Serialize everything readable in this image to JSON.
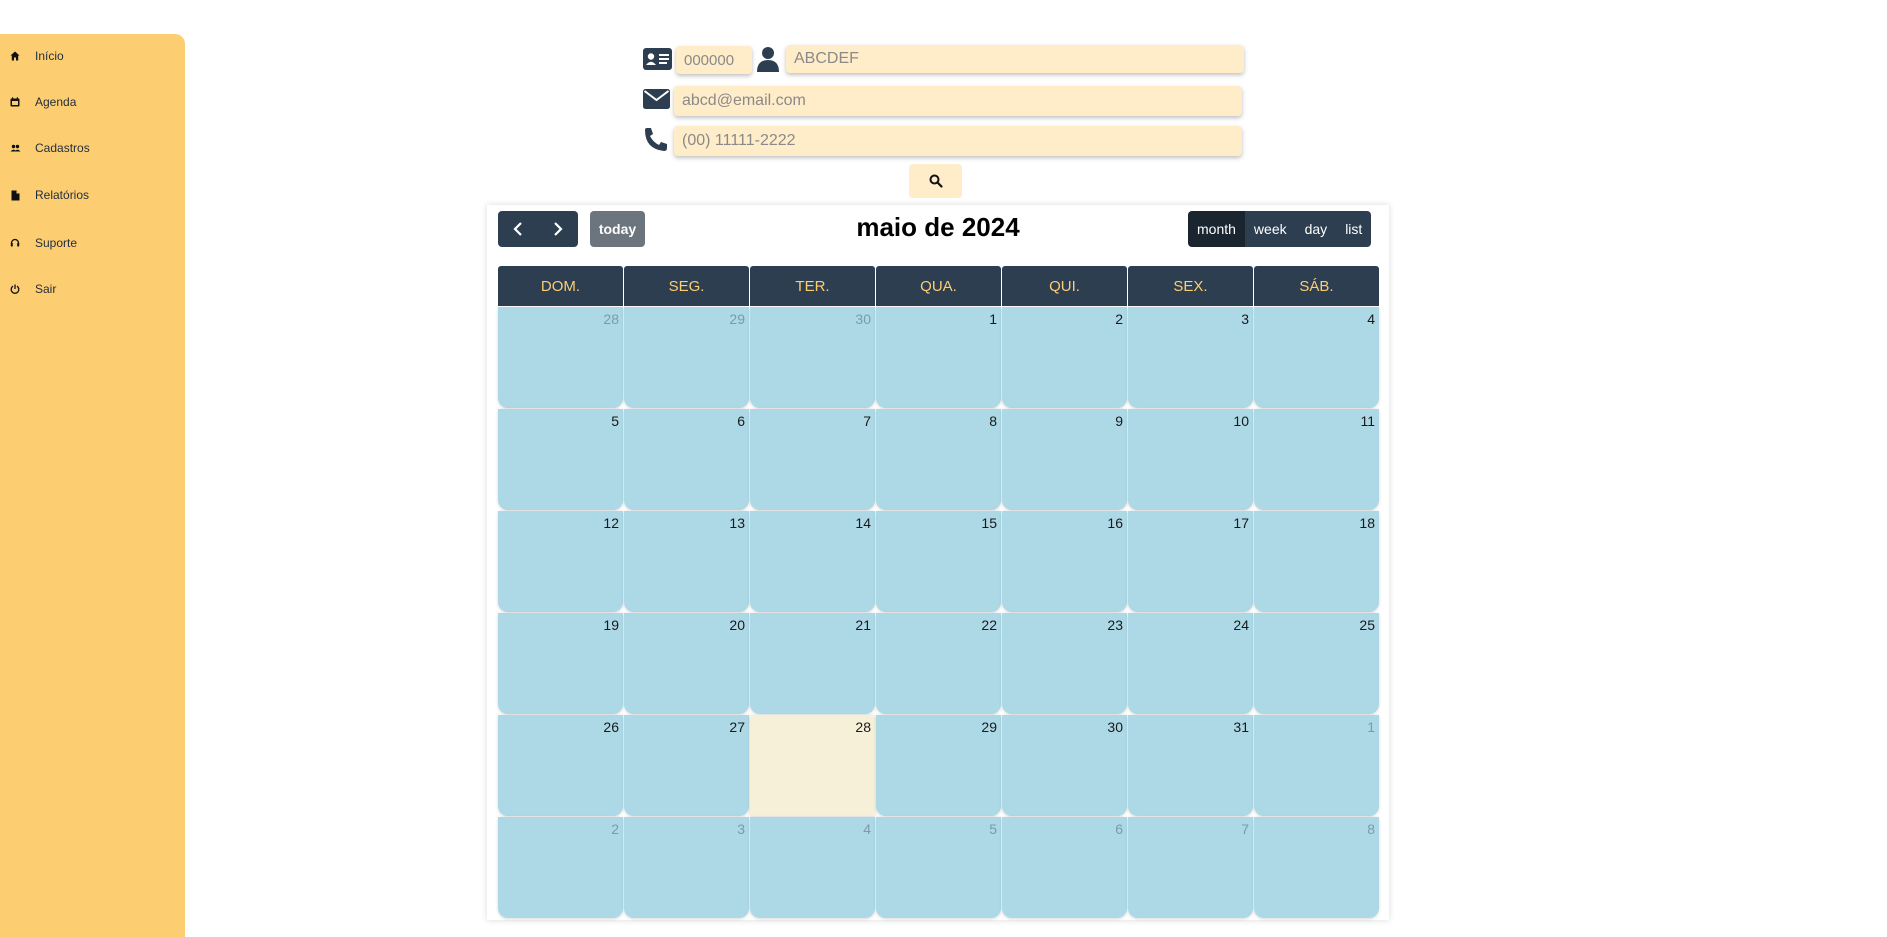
{
  "sidebar": {
    "items": [
      {
        "label": "Início",
        "icon": "home-icon"
      },
      {
        "label": "Agenda",
        "icon": "calendar-icon"
      },
      {
        "label": "Cadastros",
        "icon": "users-icon"
      },
      {
        "label": "Relatórios",
        "icon": "document-icon"
      },
      {
        "label": "Suporte",
        "icon": "headset-icon"
      },
      {
        "label": "Sair",
        "icon": "power-icon"
      }
    ]
  },
  "search": {
    "id_placeholder": "000000",
    "name_placeholder": "ABCDEF",
    "email_placeholder": "abcd@email.com",
    "phone_placeholder": "(00) 11111-2222"
  },
  "calendar": {
    "title": "maio de 2024",
    "today_label": "today",
    "views": [
      "month",
      "week",
      "day",
      "list"
    ],
    "active_view": "month",
    "weekdays": [
      "DOM.",
      "SEG.",
      "TER.",
      "QUA.",
      "QUI.",
      "SEX.",
      "SÁB."
    ],
    "weeks": [
      [
        {
          "d": "28",
          "other": true
        },
        {
          "d": "29",
          "other": true
        },
        {
          "d": "30",
          "other": true
        },
        {
          "d": "1"
        },
        {
          "d": "2"
        },
        {
          "d": "3"
        },
        {
          "d": "4"
        }
      ],
      [
        {
          "d": "5"
        },
        {
          "d": "6"
        },
        {
          "d": "7"
        },
        {
          "d": "8"
        },
        {
          "d": "9"
        },
        {
          "d": "10"
        },
        {
          "d": "11"
        }
      ],
      [
        {
          "d": "12"
        },
        {
          "d": "13"
        },
        {
          "d": "14"
        },
        {
          "d": "15"
        },
        {
          "d": "16"
        },
        {
          "d": "17"
        },
        {
          "d": "18"
        }
      ],
      [
        {
          "d": "19"
        },
        {
          "d": "20"
        },
        {
          "d": "21"
        },
        {
          "d": "22"
        },
        {
          "d": "23"
        },
        {
          "d": "24"
        },
        {
          "d": "25"
        }
      ],
      [
        {
          "d": "26"
        },
        {
          "d": "27"
        },
        {
          "d": "28",
          "today": true
        },
        {
          "d": "29"
        },
        {
          "d": "30"
        },
        {
          "d": "31"
        },
        {
          "d": "1",
          "other": true
        }
      ],
      [
        {
          "d": "2",
          "other": true
        },
        {
          "d": "3",
          "other": true
        },
        {
          "d": "4",
          "other": true
        },
        {
          "d": "5",
          "other": true
        },
        {
          "d": "6",
          "other": true
        },
        {
          "d": "7",
          "other": true
        },
        {
          "d": "8",
          "other": true
        }
      ]
    ]
  },
  "colors": {
    "sidebar_bg": "#fdcd72",
    "header_bg": "#2c3e50",
    "header_text": "#fdcd72",
    "day_bg": "#add8e6",
    "today_bg": "#f7f0d8",
    "field_bg": "#ffecc8"
  }
}
